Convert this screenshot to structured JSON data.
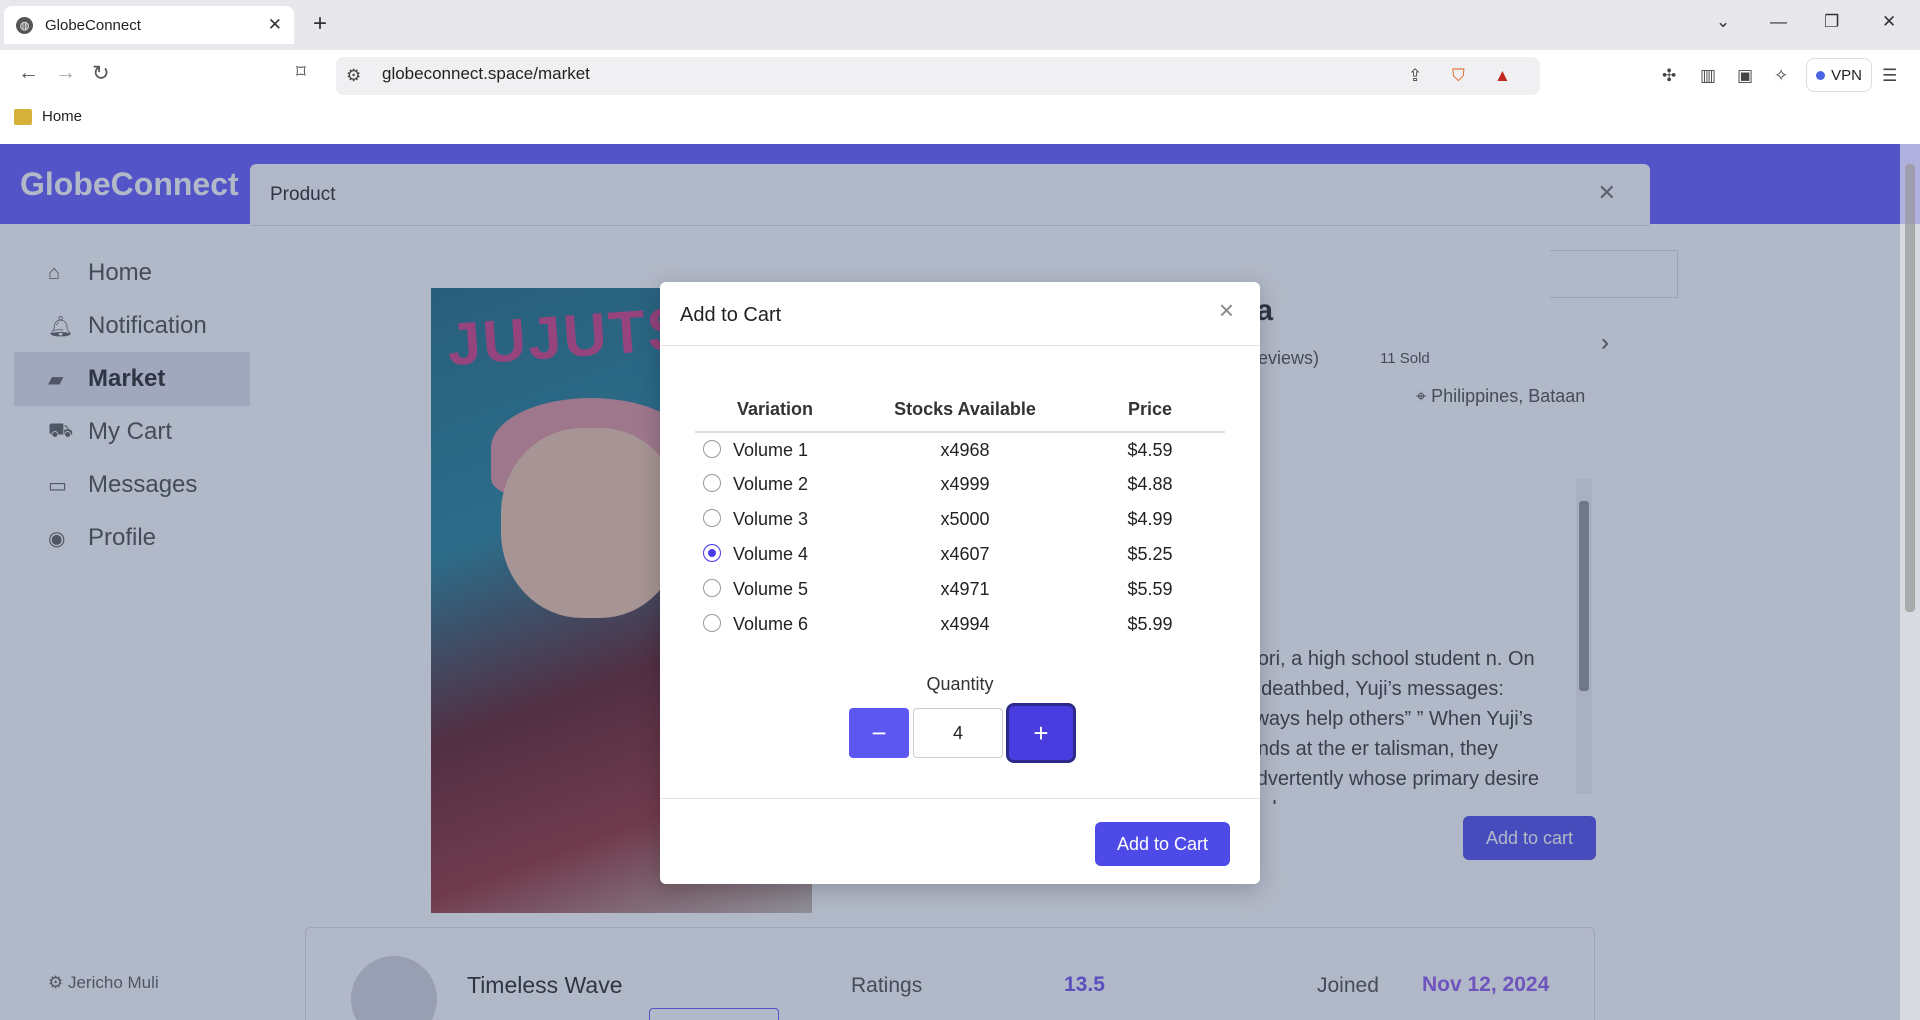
{
  "browser": {
    "tab_title": "GlobeConnect",
    "url": "globeconnect.space/market",
    "bookmark_home": "Home",
    "vpn_label": "VPN"
  },
  "app": {
    "brand": "GlobeConnect",
    "nav": [
      {
        "label": "Home",
        "icon": "home-icon"
      },
      {
        "label": "Notification",
        "icon": "bell-icon"
      },
      {
        "label": "Market",
        "icon": "bag-icon"
      },
      {
        "label": "My Cart",
        "icon": "cart-icon"
      },
      {
        "label": "Messages",
        "icon": "message-icon"
      },
      {
        "label": "Profile",
        "icon": "user-icon"
      }
    ],
    "active_nav": "Market",
    "user_name": "Jericho Muli"
  },
  "product_modal": {
    "title": "Product",
    "heading_fragment": "ga",
    "reviews_fragment": "3 Reviews)",
    "sold": "11 Sold",
    "location": "Philippines, Bataan",
    "description_fragment": "tadori, a high school student n. On his deathbed, Yuji’s messages: “Always help others” ” When Yuji’s friends at the er talisman, they inadvertently whose primary desire is to harm",
    "add_to_cart_label": "Add to cart",
    "seller": {
      "name": "Timeless Wave",
      "ratings_label": "Ratings",
      "ratings_value": "13.5",
      "joined_label": "Joined",
      "joined_value": "Nov 12, 2024"
    }
  },
  "dialog": {
    "title": "Add to Cart",
    "columns": [
      "Variation",
      "Stocks Available",
      "Price"
    ],
    "rows": [
      {
        "variation": "Volume 1",
        "stock": "x4968",
        "price": "$4.59"
      },
      {
        "variation": "Volume 2",
        "stock": "x4999",
        "price": "$4.88"
      },
      {
        "variation": "Volume 3",
        "stock": "x5000",
        "price": "$4.99"
      },
      {
        "variation": "Volume 4",
        "stock": "x4607",
        "price": "$5.25"
      },
      {
        "variation": "Volume 5",
        "stock": "x4971",
        "price": "$5.59"
      },
      {
        "variation": "Volume 6",
        "stock": "x4994",
        "price": "$5.99"
      }
    ],
    "selected_variation": "Volume 4",
    "quantity_label": "Quantity",
    "quantity_value": "4",
    "minus_label": "−",
    "plus_label": "+",
    "submit_label": "Add to Cart"
  },
  "colors": {
    "accent": "#4e4ae8",
    "appbar": "#6c63ff"
  }
}
